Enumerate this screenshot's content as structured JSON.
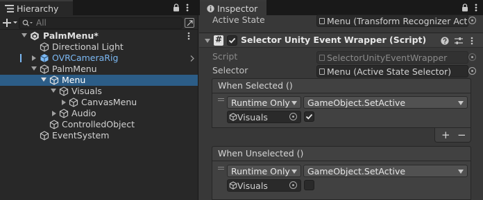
{
  "hierarchy": {
    "tab_title": "Hierarchy",
    "search_placeholder": "All",
    "rows": [
      {
        "label": "PalmMenu*",
        "bold": true,
        "kind": "scene"
      },
      {
        "label": "Directional Light"
      },
      {
        "label": "OVRCameraRig",
        "prefab": true
      },
      {
        "label": "PalmMenu"
      },
      {
        "label": "Menu",
        "selected": true
      },
      {
        "label": "Visuals"
      },
      {
        "label": "CanvasMenu"
      },
      {
        "label": "Audio"
      },
      {
        "label": "ControlledObject"
      },
      {
        "label": "EventSystem"
      }
    ]
  },
  "inspector": {
    "tab_title": "Inspector",
    "active_state_label": "Active State",
    "active_state_value": "Menu (Transform Recognizer Active State)",
    "component_title": "Selector Unity Event Wrapper (Script)",
    "script_label": "Script",
    "script_value": "SelectorUnityEventWrapper",
    "selector_label": "Selector",
    "selector_value": "Menu (Active State Selector)",
    "when_selected": {
      "header": "When Selected ()",
      "runtime": "Runtime Only",
      "function": "GameObject.SetActive",
      "object": "Visuals",
      "checked": true
    },
    "when_unselected": {
      "header": "When Unselected ()",
      "runtime": "Runtime Only",
      "function": "GameObject.SetActive",
      "object": "Visuals",
      "checked": false
    },
    "plus": "+",
    "minus": "−"
  },
  "colors": {
    "selection": "#2c5d87",
    "prefab_blue": "#7cb9f4",
    "background": "#383838"
  }
}
